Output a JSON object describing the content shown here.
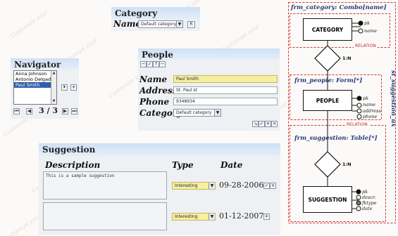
{
  "category_panel": {
    "title": "Category",
    "name_label": "Name",
    "name_value": "Default category",
    "r_button": "R"
  },
  "navigator": {
    "title": "Navigator",
    "items": [
      "Anna Johnson",
      "Antonio Delgado",
      "Paul Smith"
    ],
    "selected": "Paul Smith",
    "add_button": "+",
    "counter": "3 / 3"
  },
  "people": {
    "title": "People",
    "name_label": "Name",
    "name_value": "Paul Smith",
    "address_label": "Address",
    "address_value": "St. Paul st",
    "phone_label": "Phone",
    "phone_value": "9348934",
    "category_label": "Category",
    "category_value": "Default category"
  },
  "suggestion": {
    "title": "Suggestion",
    "col_description": "Description",
    "col_type": "Type",
    "col_date": "Date",
    "rows": [
      {
        "description": "This is a sample suggestion",
        "type": "Interesting",
        "date": "09-28-2006"
      },
      {
        "description": "",
        "type": "Interesting",
        "date": "01-12-2007"
      }
    ]
  },
  "diagram": {
    "frm_category": "frm_category: Combo[name]",
    "frm_people": "frm_people: Form[*]",
    "frm_suggestion": "frm_suggestion: Table[*]",
    "st_label": "st_suggestion_ux",
    "relation": "RELATION",
    "cardinality": "1:N",
    "entities": {
      "category": {
        "name": "CATEGORY",
        "attrs": [
          "pk",
          "name"
        ]
      },
      "people": {
        "name": "PEOPLE",
        "attrs": [
          "pk",
          "name",
          "address",
          "phone"
        ]
      },
      "suggestion": {
        "name": "SUGGESTION",
        "attrs": [
          "pk",
          "descr.",
          "fktype",
          "date"
        ]
      }
    }
  },
  "colors": {
    "panel_header": "#cfe0f5",
    "highlight_field": "#f6ef9e",
    "relation_red": "#bb2222",
    "diagram_title": "#2a3a7a"
  }
}
